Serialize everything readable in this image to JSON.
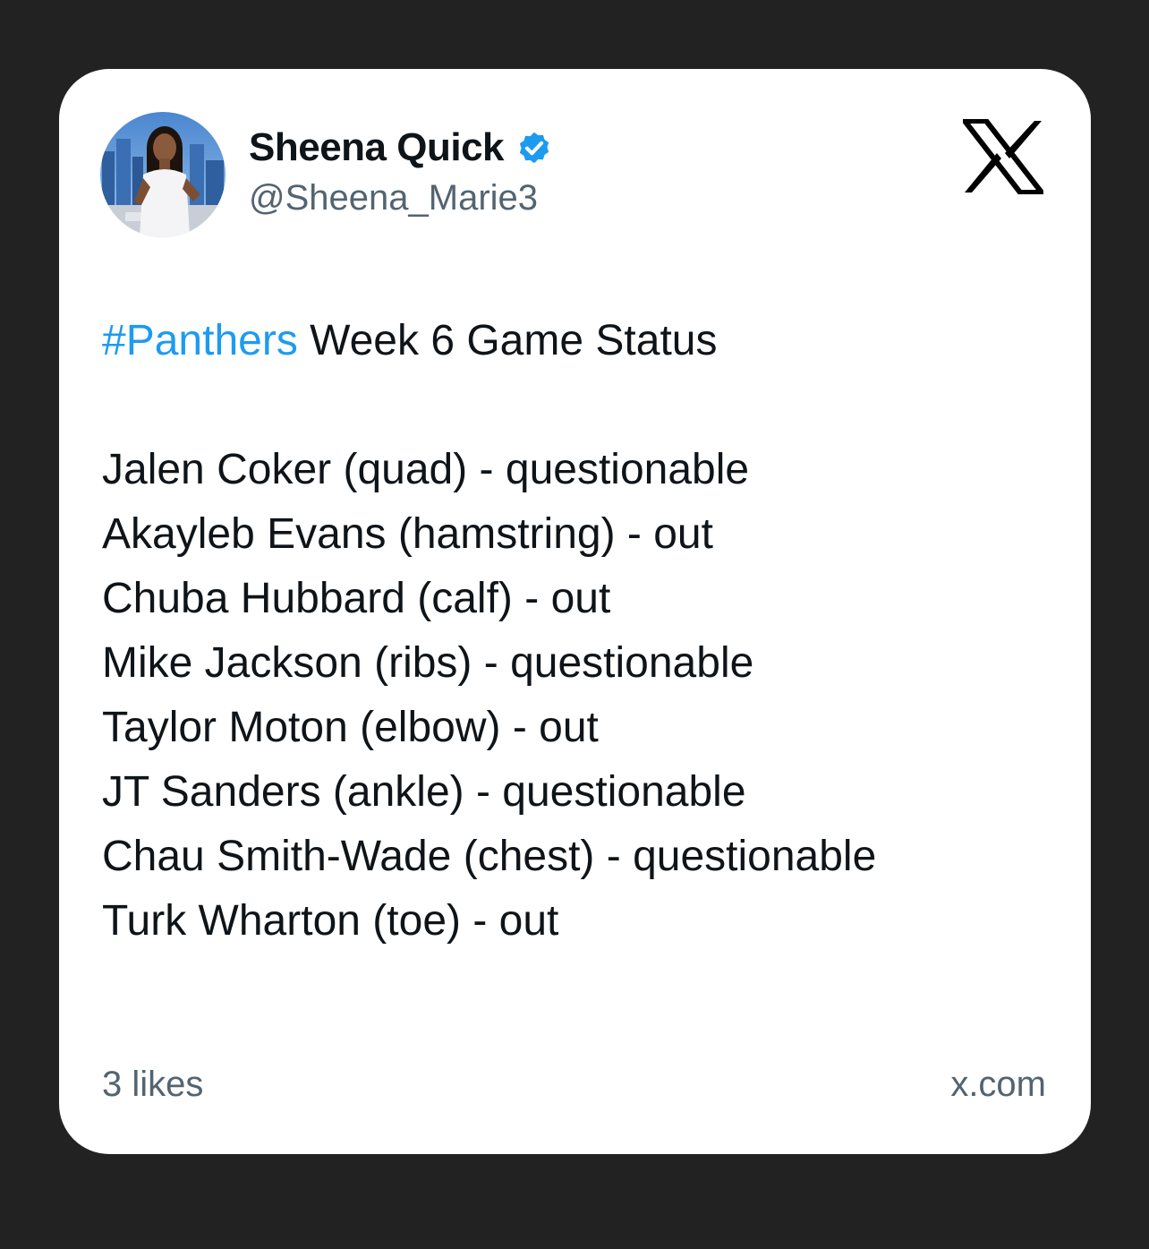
{
  "author": {
    "name": "Sheena Quick",
    "handle": "@Sheena_Marie3",
    "verified": true,
    "avatar": "avatar-photo"
  },
  "brand": {
    "logo": "x-logo-icon"
  },
  "tweet": {
    "hashtag": "#Panthers",
    "headline": " Week 6 Game Status",
    "lines": [
      "Jalen Coker (quad) - questionable",
      "Akayleb Evans (hamstring) - out",
      "Chuba Hubbard (calf) - out",
      "Mike Jackson (ribs) - questionable",
      "Taylor Moton (elbow) - out",
      "JT Sanders (ankle) - questionable",
      "Chau Smith-Wade (chest) - questionable",
      "Turk Wharton (toe) - out"
    ]
  },
  "footer": {
    "likes": "3 likes",
    "domain": "x.com"
  },
  "colors": {
    "background": "#222222",
    "card": "#ffffff",
    "text": "#0f1419",
    "secondary": "#536471",
    "link": "#1d9bf0",
    "verified": "#1d9bf0"
  }
}
